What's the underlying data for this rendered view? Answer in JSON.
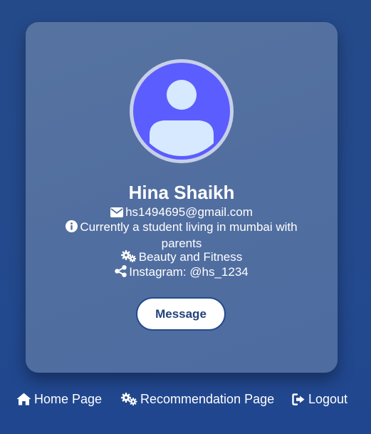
{
  "profile": {
    "name": "Hina Shaikh",
    "email": "hs1494695@gmail.com",
    "bio": "Currently a student living in mumbai with parents",
    "interest": "Beauty and Fitness",
    "instagram": "Instagram: @hs_1234"
  },
  "actions": {
    "message_label": "Message"
  },
  "nav": {
    "home_label": "Home Page",
    "recommendation_label": "Recommendation Page",
    "logout_label": "Logout"
  },
  "icons": {
    "avatar": "user-avatar-icon",
    "email": "envelope-icon",
    "bio": "info-icon",
    "interest": "gears-icon",
    "instagram": "share-icon",
    "home": "home-icon",
    "recommendation": "gears-icon",
    "logout": "sign-out-icon"
  },
  "colors": {
    "page_background": "#244a8d",
    "card_background": "#5270a0",
    "avatar_ring": "#c7d0e6",
    "avatar_fill": "#5b5dff",
    "avatar_figure": "#d6e9ff",
    "button_text": "#22427a"
  }
}
